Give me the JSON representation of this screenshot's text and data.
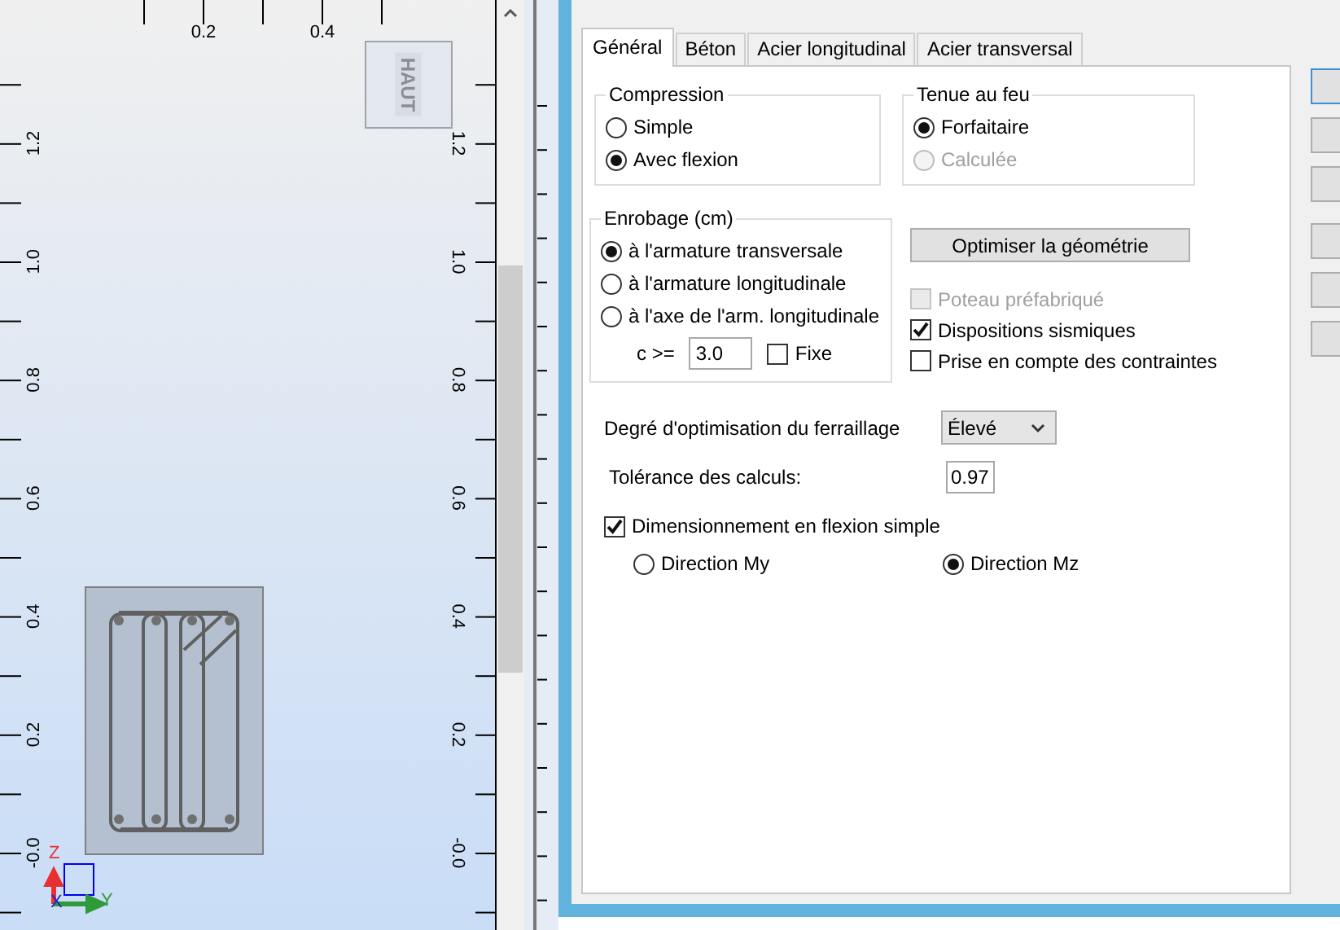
{
  "viewport": {
    "top_axis": [
      "0.2",
      "0.4"
    ],
    "left_axis": [
      "1.2",
      "1.0",
      "0.8",
      "0.6",
      "0.4",
      "0.2",
      "-0.0"
    ],
    "right_axis": [
      "1.2",
      "1.0",
      "0.8",
      "0.6",
      "0.4",
      "0.2",
      "-0.0"
    ],
    "view_button": "HAUT",
    "triad": {
      "z": "Z",
      "x": "X",
      "y": "Y"
    }
  },
  "dialog": {
    "tabs": [
      {
        "label": "Général",
        "selected": true
      },
      {
        "label": "Béton",
        "selected": false
      },
      {
        "label": "Acier longitudinal",
        "selected": false
      },
      {
        "label": "Acier transversal",
        "selected": false
      }
    ],
    "compression": {
      "title": "Compression",
      "options": [
        {
          "label": "Simple",
          "selected": false
        },
        {
          "label": "Avec flexion",
          "selected": true
        }
      ]
    },
    "fire": {
      "title": "Tenue au feu",
      "options": [
        {
          "label": "Forfaitaire",
          "selected": true,
          "disabled": false
        },
        {
          "label": "Calculée",
          "selected": false,
          "disabled": true
        }
      ]
    },
    "cover": {
      "title": "Enrobage (cm)",
      "options": [
        {
          "label": "à l'armature transversale",
          "selected": true
        },
        {
          "label": "à l'armature longitudinale",
          "selected": false
        },
        {
          "label": "à l'axe de l'arm. longitudinale",
          "selected": false
        }
      ],
      "c_label": "c >=",
      "c_value": "3.0",
      "fixed": {
        "label": "Fixe",
        "checked": false
      }
    },
    "optimize_button": "Optimiser la géométrie",
    "checkboxes": [
      {
        "label": "Poteau préfabriqué",
        "checked": false,
        "disabled": true
      },
      {
        "label": "Dispositions sismiques",
        "checked": true,
        "disabled": false
      },
      {
        "label": "Prise en compte des contraintes",
        "checked": false,
        "disabled": false
      }
    ],
    "optimization": {
      "label": "Degré d'optimisation du ferraillage",
      "value": "Élevé"
    },
    "tolerance": {
      "label": "Tolérance des calculs:",
      "value": "0.97"
    },
    "bending": {
      "label": "Dimensionnement en flexion simple",
      "checked": true,
      "directions": [
        {
          "label": "Direction My",
          "selected": false
        },
        {
          "label": "Direction Mz",
          "selected": true
        }
      ]
    }
  }
}
